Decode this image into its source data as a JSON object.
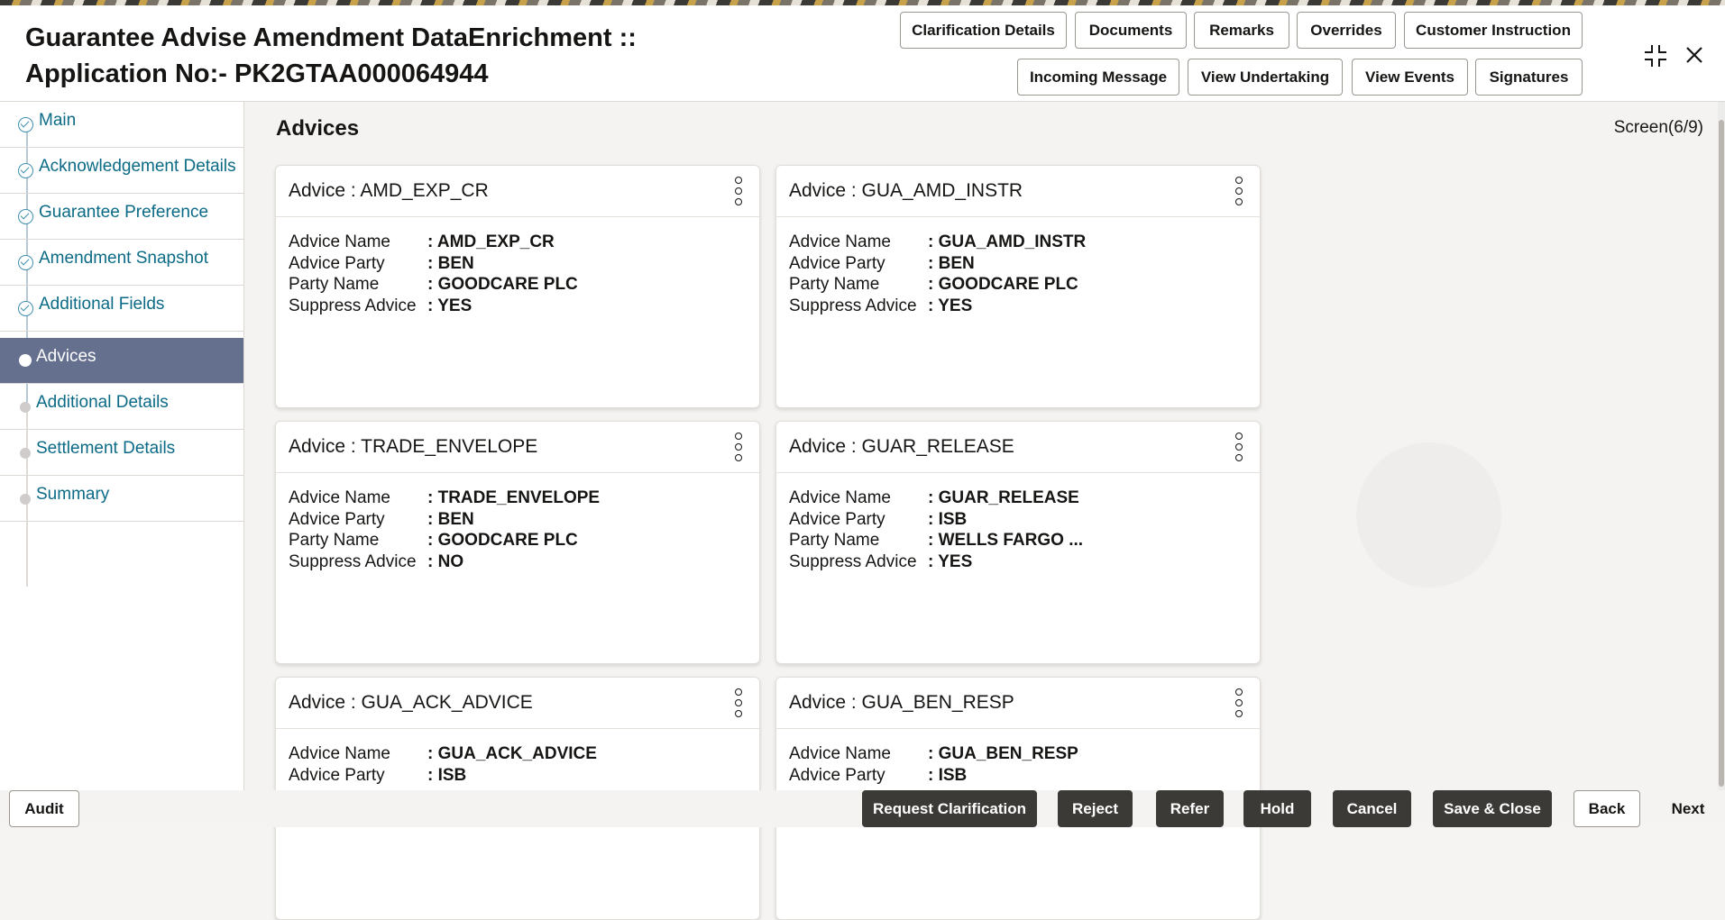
{
  "header": {
    "title": "Guarantee Advise Amendment DataEnrichment ::\nApplication No:- PK2GTAA000064944",
    "buttons_row1": [
      "Clarification Details",
      "Documents",
      "Remarks",
      "Overrides",
      "Customer Instruction"
    ],
    "buttons_row2": [
      "Incoming Message",
      "View Undertaking",
      "View Events",
      "Signatures"
    ],
    "window_icons": [
      "collapse-icon",
      "close-icon"
    ]
  },
  "sidebar": {
    "items": [
      {
        "label": "Main",
        "status": "complete"
      },
      {
        "label": "Acknowledgement Details",
        "status": "complete"
      },
      {
        "label": "Guarantee Preference",
        "status": "complete"
      },
      {
        "label": "Amendment Snapshot",
        "status": "complete"
      },
      {
        "label": "Additional Fields",
        "status": "complete"
      },
      {
        "label": "Advices",
        "status": "active"
      },
      {
        "label": "Additional Details",
        "status": "pending"
      },
      {
        "label": "Settlement Details",
        "status": "pending"
      },
      {
        "label": "Summary",
        "status": "pending"
      }
    ]
  },
  "main": {
    "heading": "Advices",
    "screen_indicator": "Screen(6/9)",
    "field_labels": {
      "advice_name": "Advice Name",
      "advice_party": "Advice Party",
      "party_name": "Party Name",
      "suppress_advice": "Suppress Advice"
    },
    "cards": [
      {
        "title": "Advice : AMD_EXP_CR",
        "advice_name": ": AMD_EXP_CR",
        "advice_party": ": BEN",
        "party_name": ": GOODCARE PLC",
        "suppress_advice": ": YES"
      },
      {
        "title": "Advice : GUA_AMD_INSTR",
        "advice_name": ": GUA_AMD_INSTR",
        "advice_party": ": BEN",
        "party_name": ": GOODCARE PLC",
        "suppress_advice": ": YES"
      },
      {
        "title": "Advice : TRADE_ENVELOPE",
        "advice_name": ": TRADE_ENVELOPE",
        "advice_party": ": BEN",
        "party_name": ": GOODCARE PLC",
        "suppress_advice": ": NO"
      },
      {
        "title": "Advice : GUAR_RELEASE",
        "advice_name": ": GUAR_RELEASE",
        "advice_party": ": ISB",
        "party_name": ": WELLS FARGO ...",
        "suppress_advice": ": YES"
      },
      {
        "title": "Advice : GUA_ACK_ADVICE",
        "advice_name": ": GUA_ACK_ADVICE",
        "advice_party": ": ISB"
      },
      {
        "title": "Advice : GUA_BEN_RESP",
        "advice_name": ": GUA_BEN_RESP",
        "advice_party": ": ISB"
      }
    ]
  },
  "footer": {
    "audit": "Audit",
    "actions": [
      "Request Clarification",
      "Reject",
      "Refer",
      "Hold",
      "Cancel",
      "Save & Close"
    ],
    "back": "Back",
    "next": "Next"
  },
  "colors": {
    "active_nav_bg": "#65708f",
    "link_text": "#0b6b86",
    "dark_button": "#3c3a37"
  }
}
